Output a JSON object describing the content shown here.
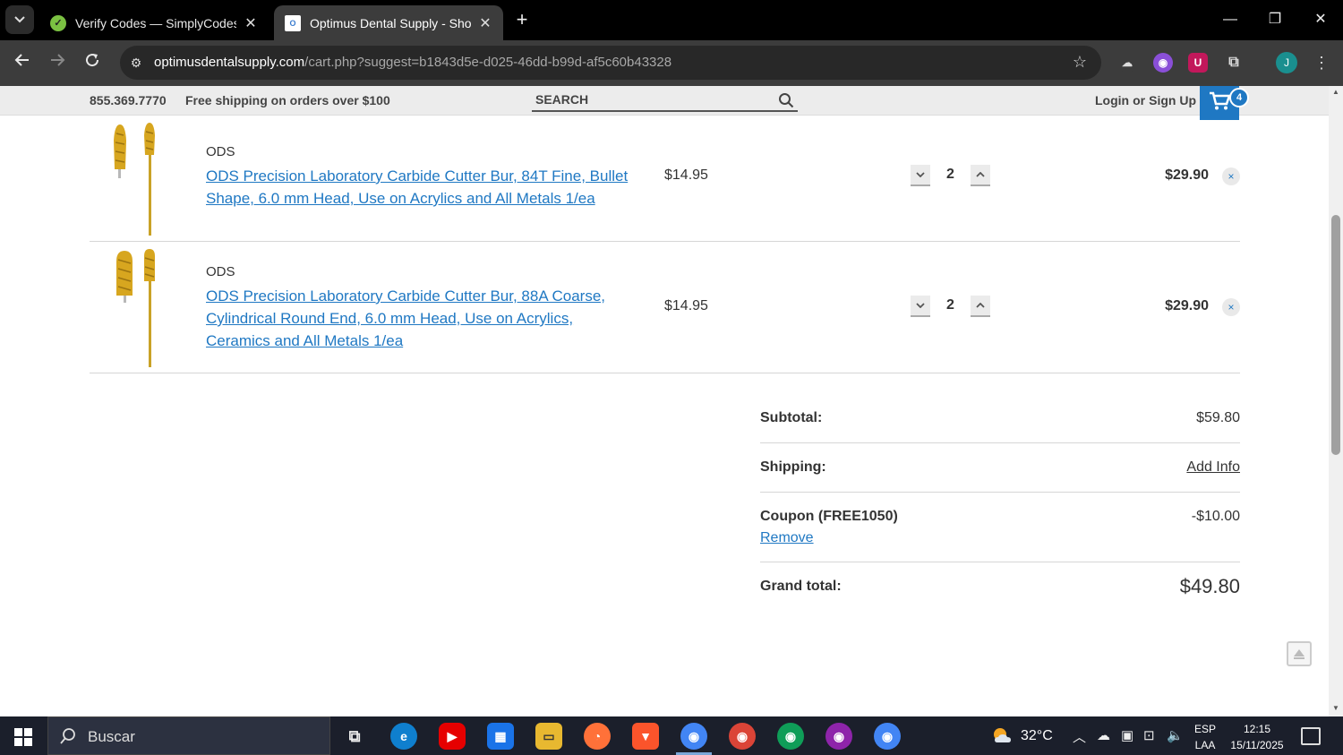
{
  "browser": {
    "tabs": [
      {
        "title": "Verify Codes — SimplyCodes",
        "active": false,
        "favicon": "simplycodes-icon"
      },
      {
        "title": "Optimus Dental Supply - Shopp",
        "active": true,
        "favicon": "optimus-icon"
      }
    ],
    "url_host": "optimusdentalsupply.com",
    "url_path": "/cart.php?suggest=b1843d5e-d025-46dd-b99d-af5c60b43328",
    "profile_initial": "J"
  },
  "header": {
    "phone": "855.369.7770",
    "shipping_msg": "Free shipping on orders over $100",
    "search_placeholder": "SEARCH",
    "login": "Login",
    "or": "or",
    "signup": "Sign Up",
    "cart_count": "4"
  },
  "cart": {
    "items": [
      {
        "brand": "ODS",
        "name": "ODS Precision Laboratory Carbide Cutter Bur, 84T Fine, Bullet Shape, 6.0 mm Head, Use on Acrylics and All Metals 1/ea",
        "unit_price": "$14.95",
        "qty": "2",
        "line_total": "$29.90"
      },
      {
        "brand": "ODS",
        "name": "ODS Precision Laboratory Carbide Cutter Bur, 88A Coarse, Cylindrical Round End, 6.0 mm Head, Use on Acrylics, Ceramics and All Metals 1/ea",
        "unit_price": "$14.95",
        "qty": "2",
        "line_total": "$29.90"
      }
    ],
    "remove_symbol": "×"
  },
  "totals": {
    "subtotal_label": "Subtotal:",
    "subtotal_value": "$59.80",
    "shipping_label": "Shipping:",
    "shipping_value": "Add Info",
    "coupon_label": "Coupon (FREE1050)",
    "coupon_value": "-$10.00",
    "coupon_remove": "Remove",
    "grand_label": "Grand total:",
    "grand_value": "$49.80"
  },
  "taskbar": {
    "search_placeholder": "Buscar",
    "weather": "32°C",
    "lang_top": "ESP",
    "lang_bottom": "LAA",
    "time": "12:15",
    "date": "15/11/2025"
  },
  "colors": {
    "accent": "#1f78c3",
    "header_bg": "#ececec",
    "taskbar_bg": "#1b1f2b"
  }
}
